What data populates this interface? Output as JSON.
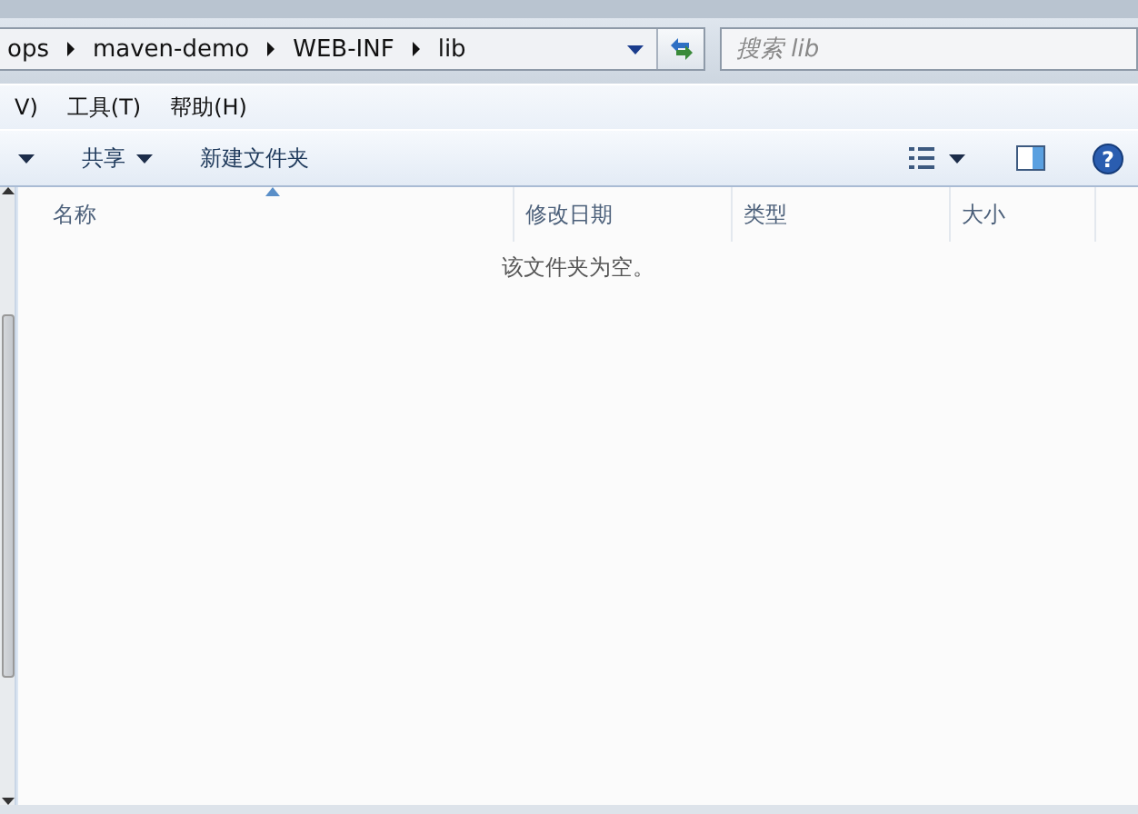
{
  "address_bar": {
    "breadcrumbs": [
      "ops",
      "maven-demo",
      "WEB-INF",
      "lib"
    ]
  },
  "search": {
    "placeholder": "搜索 lib"
  },
  "menu_bar": [
    "V)",
    "工具(T)",
    "帮助(H)"
  ],
  "toolbar": {
    "help_button": "?",
    "buttons": [
      {
        "dropdown": true
      },
      {
        "label": "共享",
        "dropdown": true
      },
      {
        "label": "新建文件夹",
        "dropdown": false
      }
    ]
  },
  "file_list": {
    "columns": [
      {
        "label": "名称",
        "sorted": true
      },
      {
        "label": "修改日期",
        "sorted": false
      },
      {
        "label": "类型",
        "sorted": false
      },
      {
        "label": "大小",
        "sorted": false
      }
    ],
    "empty_message": "该文件夹为空。"
  }
}
